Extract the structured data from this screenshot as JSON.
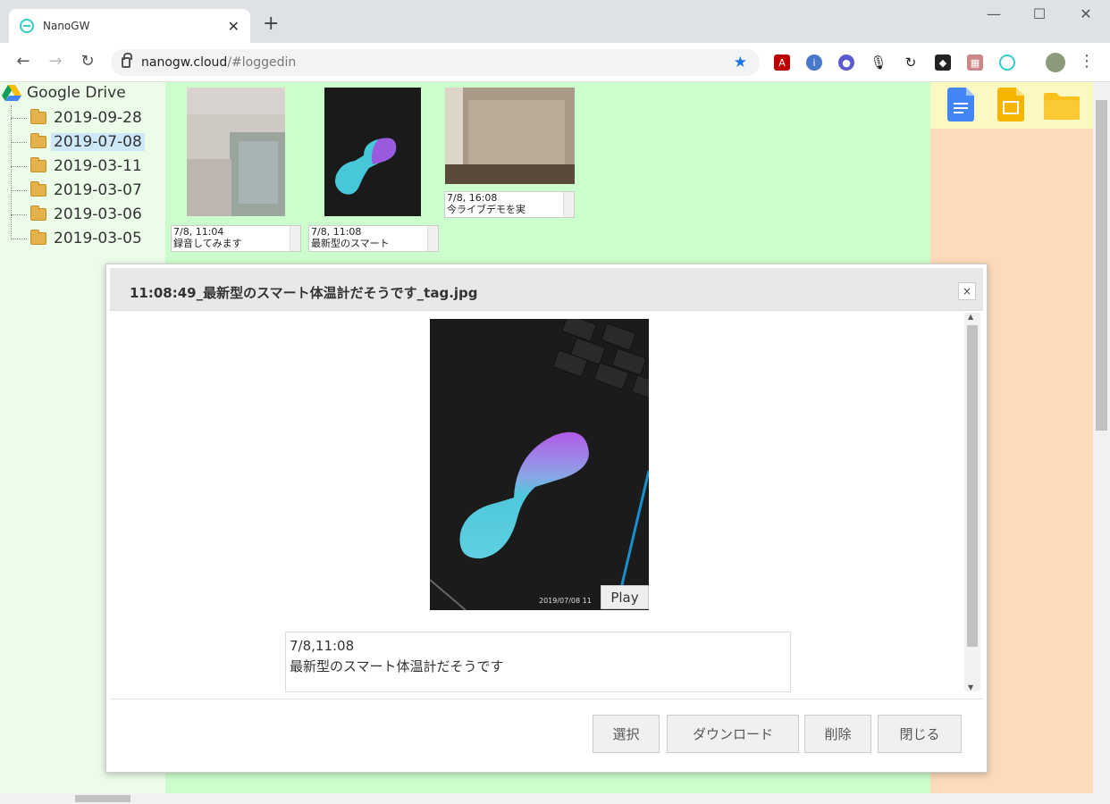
{
  "browser": {
    "tab_title": "NanoGW",
    "tab_close": "✕",
    "new_tab": "+",
    "window_min": "—",
    "window_max": "☐",
    "window_close": "✕",
    "nav_back": "←",
    "nav_forward": "→",
    "nav_reload": "↻",
    "url_host": "nanogw.cloud",
    "url_path": "/#loggedin",
    "menu": "⋮"
  },
  "sidebar": {
    "root_label": "Google Drive",
    "items": [
      {
        "label": "2019-09-28",
        "selected": false
      },
      {
        "label": "2019-07-08",
        "selected": true
      },
      {
        "label": "2019-03-11",
        "selected": false
      },
      {
        "label": "2019-03-07",
        "selected": false
      },
      {
        "label": "2019-03-06",
        "selected": false
      },
      {
        "label": "2019-03-05",
        "selected": false
      }
    ]
  },
  "thumbnails": [
    {
      "caption_line1": "7/8, 11:04",
      "caption_line2": "録音してみます"
    },
    {
      "caption_line1": "7/8, 11:08",
      "caption_line2": "最新型のスマート"
    },
    {
      "caption_line1": "7/8, 16:08",
      "caption_line2": "今ライブデモを実"
    }
  ],
  "right_icons": [
    "docs-icon",
    "slides-icon",
    "folder-icon"
  ],
  "dialog": {
    "title": "11:08:49_最新型のスマート体温計だそうです_tag.jpg",
    "close": "×",
    "photo_stamp": "2019/07/08 11",
    "play_label": "Play",
    "memo_line1": "7/8,11:08",
    "memo_line2": "最新型のスマート体温計だそうです",
    "buttons": {
      "select": "選択",
      "download": "ダウンロード",
      "delete": "削除",
      "close": "閉じる"
    }
  }
}
